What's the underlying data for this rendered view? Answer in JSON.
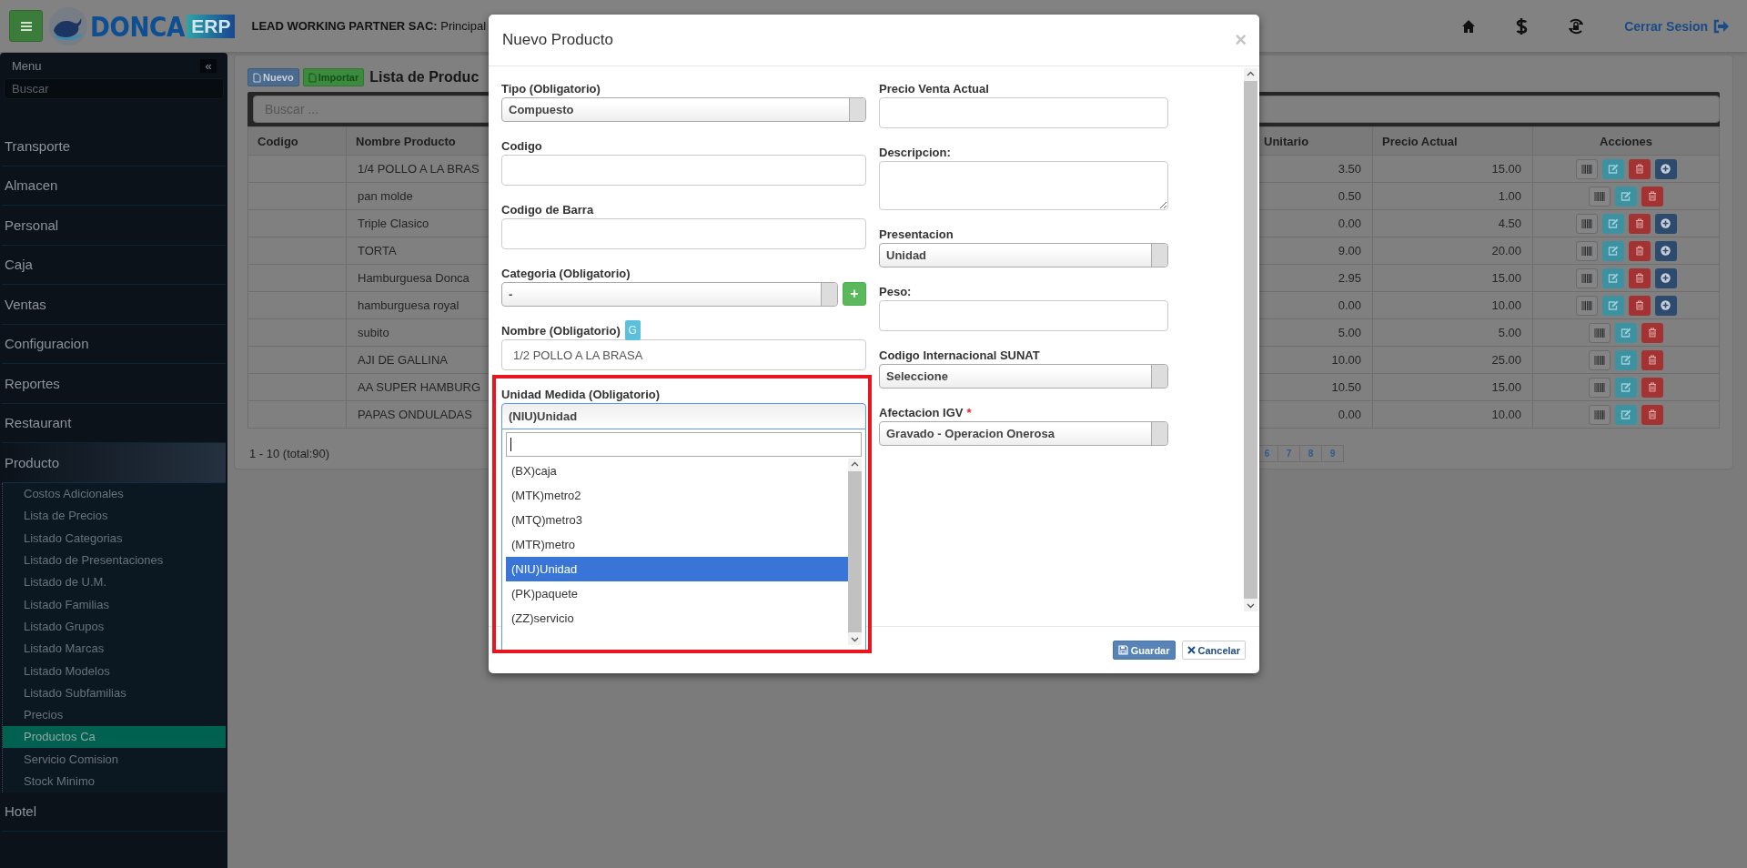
{
  "header": {
    "logo_text": "DONCA",
    "logo_badge": "ERP",
    "company_label": "LEAD WORKING PARTNER SAC:",
    "company_name": "Principal",
    "logout": "Cerrar Sesion"
  },
  "sidebar": {
    "title": "Menu",
    "collapse": "«",
    "search_placeholder": "Buscar",
    "items": [
      {
        "label": "Transporte",
        "expanded": false
      },
      {
        "label": "Almacen",
        "expanded": false
      },
      {
        "label": "Personal",
        "expanded": false
      },
      {
        "label": "Caja",
        "expanded": false
      },
      {
        "label": "Ventas",
        "expanded": false
      },
      {
        "label": "Configuracion",
        "expanded": false
      },
      {
        "label": "Reportes",
        "expanded": false
      },
      {
        "label": "Restaurant",
        "expanded": false
      },
      {
        "label": "Producto",
        "expanded": true,
        "children": [
          {
            "label": "Costos Adicionales",
            "selected": false
          },
          {
            "label": "Lista de Precios",
            "selected": false
          },
          {
            "label": "Listado Categorias",
            "selected": false
          },
          {
            "label": "Listado de Presentaciones",
            "selected": false
          },
          {
            "label": "Listado de U.M.",
            "selected": false
          },
          {
            "label": "Listado Familias",
            "selected": false
          },
          {
            "label": "Listado Grupos",
            "selected": false
          },
          {
            "label": "Listado Marcas",
            "selected": false
          },
          {
            "label": "Listado Modelos",
            "selected": false
          },
          {
            "label": "Listado Subfamilias",
            "selected": false
          },
          {
            "label": "Precios",
            "selected": false
          },
          {
            "label": "Productos Ca",
            "selected": true
          },
          {
            "label": "Servicio Comision",
            "selected": false
          },
          {
            "label": "Stock Minimo",
            "selected": false
          }
        ]
      },
      {
        "label": "Hotel",
        "expanded": false
      }
    ]
  },
  "content": {
    "buttons": [
      {
        "label": "Nuevo",
        "kind": "primary"
      },
      {
        "label": "Importar",
        "kind": "success"
      }
    ],
    "title": "Lista de Produc",
    "search_placeholder": "Buscar ...",
    "table": {
      "columns": [
        "Codigo",
        "Nombre Producto",
        "Unitario",
        "Precio Actual",
        "Acciones"
      ],
      "rows": [
        {
          "name": "1/4 POLLO A LA BRAS",
          "unitario": "3.50",
          "precio_actual": "15.00",
          "actions": [
            {
              "kind": "barcode"
            },
            {
              "kind": "edit"
            },
            {
              "kind": "delete"
            },
            {
              "kind": "add"
            }
          ]
        },
        {
          "name": "pan molde",
          "unitario": "0.50",
          "precio_actual": "1.00",
          "actions": [
            {
              "kind": "barcode"
            },
            {
              "kind": "edit"
            },
            {
              "kind": "delete"
            }
          ]
        },
        {
          "name": "Triple Clasico",
          "unitario": "0.00",
          "precio_actual": "4.50",
          "actions": [
            {
              "kind": "barcode"
            },
            {
              "kind": "edit"
            },
            {
              "kind": "delete"
            },
            {
              "kind": "add"
            }
          ]
        },
        {
          "name": "TORTA",
          "unitario": "9.00",
          "precio_actual": "20.00",
          "actions": [
            {
              "kind": "barcode"
            },
            {
              "kind": "edit"
            },
            {
              "kind": "delete"
            },
            {
              "kind": "add"
            }
          ]
        },
        {
          "name": "Hamburguesa Donca",
          "unitario": "2.95",
          "precio_actual": "15.00",
          "actions": [
            {
              "kind": "barcode"
            },
            {
              "kind": "edit"
            },
            {
              "kind": "delete"
            },
            {
              "kind": "add"
            }
          ]
        },
        {
          "name": "hamburguesa royal",
          "unitario": "0.00",
          "precio_actual": "10.00",
          "actions": [
            {
              "kind": "barcode"
            },
            {
              "kind": "edit"
            },
            {
              "kind": "delete"
            },
            {
              "kind": "add"
            }
          ]
        },
        {
          "name": "subito",
          "unitario": "5.00",
          "precio_actual": "5.00",
          "actions": [
            {
              "kind": "barcode"
            },
            {
              "kind": "edit"
            },
            {
              "kind": "delete"
            }
          ]
        },
        {
          "name": "AJI DE GALLINA",
          "unitario": "10.00",
          "precio_actual": "25.00",
          "actions": [
            {
              "kind": "barcode"
            },
            {
              "kind": "edit"
            },
            {
              "kind": "delete"
            }
          ]
        },
        {
          "name": "AA SUPER HAMBURG",
          "unitario": "10.50",
          "precio_actual": "15.00",
          "actions": [
            {
              "kind": "barcode"
            },
            {
              "kind": "edit"
            },
            {
              "kind": "delete"
            }
          ]
        },
        {
          "name": "PAPAS ONDULADAS",
          "unitario": "0.00",
          "precio_actual": "10.00",
          "actions": [
            {
              "kind": "barcode"
            },
            {
              "kind": "edit"
            },
            {
              "kind": "delete"
            }
          ]
        }
      ]
    },
    "pagination": {
      "summary": "1 - 10 (total:90)",
      "pages": [
        "6",
        "7",
        "8",
        "9"
      ]
    }
  },
  "modal": {
    "title": "Nuevo Producto",
    "close": "×",
    "left_fields": [
      {
        "kind": "select",
        "label": "Tipo (Obligatorio)",
        "value": "Compuesto"
      },
      {
        "kind": "input",
        "label": "Codigo"
      },
      {
        "kind": "input",
        "label": "Codigo de Barra"
      },
      {
        "kind": "select",
        "label": "Categoria (Obligatorio)",
        "value": "-",
        "add_button": "+"
      },
      {
        "kind": "input",
        "label": "Nombre (Obligatorio)",
        "badge": "G",
        "value": "1/2 POLLO A LA BRASA"
      },
      {
        "kind": "open_select",
        "label": "Unidad Medida (Obligatorio)",
        "value": "(NIU)Unidad",
        "highlighted": true,
        "options": [
          {
            "label": "(BX)caja",
            "selected": false
          },
          {
            "label": "(MTK)metro2",
            "selected": false
          },
          {
            "label": "(MTQ)metro3",
            "selected": false
          },
          {
            "label": "(MTR)metro",
            "selected": false
          },
          {
            "label": "(NIU)Unidad",
            "selected": true
          },
          {
            "label": "(PK)paquete",
            "selected": false
          },
          {
            "label": "(ZZ)servicio",
            "selected": false
          }
        ]
      }
    ],
    "right_fields": [
      {
        "kind": "input",
        "label": "Precio Venta Actual"
      },
      {
        "kind": "textarea",
        "label": "Descripcion:"
      },
      {
        "kind": "select",
        "label": "Presentacion",
        "value": "Unidad"
      },
      {
        "kind": "input",
        "label": "Peso:"
      },
      {
        "kind": "select",
        "label": "Codigo Internacional SUNAT",
        "value": "Seleccione"
      },
      {
        "kind": "select",
        "label": "Afectacion IGV",
        "required_mark": "*",
        "value": "Gravado - Operacion Onerosa"
      }
    ],
    "buttons": [
      {
        "label": "Guardar",
        "kind": "primary"
      },
      {
        "label": "Cancelar",
        "kind": "default"
      }
    ]
  }
}
